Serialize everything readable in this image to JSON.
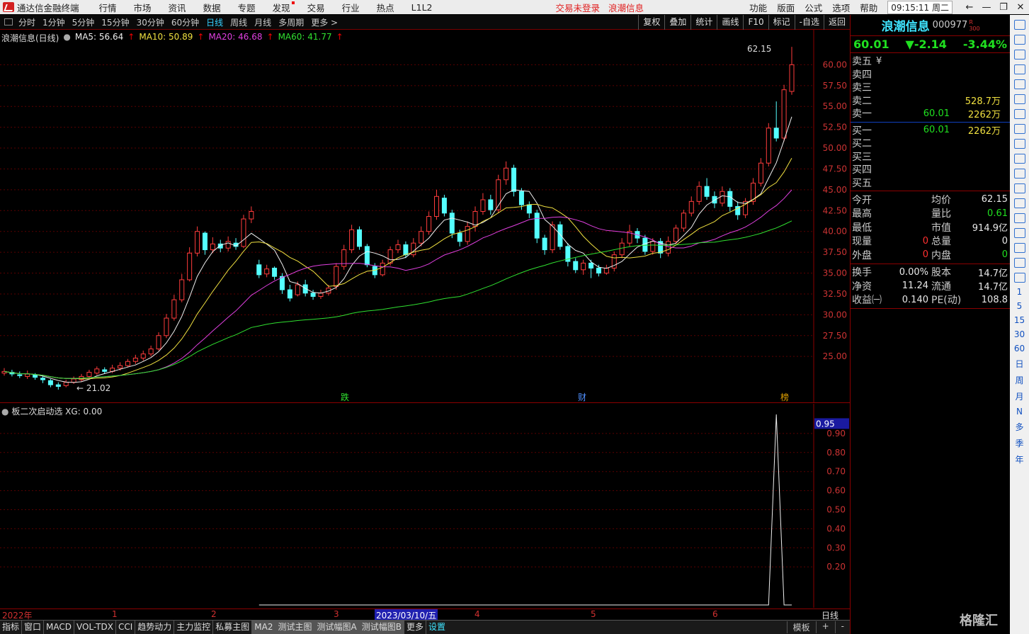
{
  "menubar": {
    "app_title": "通达信金融终端",
    "items": [
      "行情",
      "市场",
      "资讯",
      "数据",
      "专题",
      "发现",
      "交易",
      "行业",
      "热点",
      "L1L2"
    ],
    "alert_trade": "交易未登录",
    "alert_stock": "浪潮信息",
    "right_items": [
      "功能",
      "版面",
      "公式",
      "选项",
      "帮助"
    ],
    "clock": "09:15:11",
    "weekday": "周二"
  },
  "periodbar": {
    "items": [
      "分时",
      "1分钟",
      "5分钟",
      "15分钟",
      "30分钟",
      "60分钟",
      "日线",
      "周线",
      "月线",
      "多周期",
      "更多 >"
    ],
    "active": "日线",
    "tools": [
      "复权",
      "叠加",
      "统计",
      "画线",
      "F10",
      "标记",
      "-自选",
      "返回"
    ]
  },
  "main_legend": {
    "title": "浪潮信息(日线)",
    "ma5": "MA5: 56.64",
    "ma10": "MA10: 50.89",
    "ma20": "MA20: 46.68",
    "ma60": "MA60: 41.77"
  },
  "main_chart": {
    "price_labels": [
      "60.00",
      "57.50",
      "55.00",
      "52.50",
      "50.00",
      "47.50",
      "45.00",
      "42.50",
      "40.00",
      "37.50",
      "35.00",
      "32.50",
      "30.00",
      "27.50",
      "25.00"
    ],
    "high_label": "62.15",
    "low_label": "21.02",
    "markers": [
      "跌",
      "财",
      "榜"
    ]
  },
  "ind_legend": {
    "title": "板二次启动选",
    "xg": "XG: 0.00"
  },
  "ind_chart": {
    "value_label": "0.95",
    "axis_labels": [
      "0.90",
      "0.80",
      "0.70",
      "0.60",
      "0.50",
      "0.40",
      "0.30",
      "0.20"
    ]
  },
  "chart_data": {
    "type": "candlestick",
    "ylim": [
      20,
      62.5
    ],
    "candles": [
      [
        23.0,
        23.2,
        23.6,
        22.7
      ],
      [
        23.1,
        22.9,
        23.4,
        22.6
      ],
      [
        22.8,
        22.7,
        23.2,
        22.4
      ],
      [
        22.6,
        22.9,
        23.3,
        22.3
      ],
      [
        22.8,
        22.5,
        23.0,
        22.2
      ],
      [
        22.4,
        22.2,
        22.7,
        21.8
      ],
      [
        22.1,
        21.6,
        22.3,
        21.3
      ],
      [
        21.6,
        21.4,
        21.9,
        21.02
      ],
      [
        21.5,
        21.9,
        22.2,
        21.3
      ],
      [
        21.9,
        22.3,
        22.6,
        21.7
      ],
      [
        22.2,
        22.6,
        22.9,
        22.0
      ],
      [
        22.6,
        23.1,
        23.4,
        22.4
      ],
      [
        23.0,
        23.5,
        23.8,
        22.8
      ],
      [
        23.4,
        23.2,
        23.7,
        22.9
      ],
      [
        23.2,
        23.6,
        24.0,
        23.0
      ],
      [
        23.6,
        23.9,
        24.3,
        23.3
      ],
      [
        23.9,
        24.4,
        24.7,
        23.7
      ],
      [
        24.4,
        24.8,
        25.2,
        24.1
      ],
      [
        24.8,
        25.3,
        25.7,
        24.5
      ],
      [
        25.3,
        25.9,
        26.3,
        25.0
      ],
      [
        25.9,
        27.5,
        27.9,
        25.7
      ],
      [
        27.5,
        29.6,
        30.1,
        27.2
      ],
      [
        29.6,
        31.8,
        32.4,
        29.3
      ],
      [
        31.8,
        34.2,
        34.9,
        31.5
      ],
      [
        34.2,
        37.4,
        38.1,
        34.0
      ],
      [
        37.4,
        40.0,
        40.6,
        37.0
      ],
      [
        39.8,
        37.8,
        40.0,
        37.2
      ],
      [
        37.8,
        38.5,
        39.3,
        37.4
      ],
      [
        38.5,
        38.0,
        39.0,
        37.5
      ],
      [
        38.0,
        38.8,
        39.4,
        37.6
      ],
      [
        38.6,
        38.2,
        39.2,
        37.8
      ],
      [
        38.2,
        41.5,
        42.0,
        38.0
      ],
      [
        41.5,
        42.4,
        43.0,
        41.0
      ],
      [
        36.0,
        34.8,
        36.6,
        34.4
      ],
      [
        34.9,
        35.5,
        36.0,
        34.5
      ],
      [
        35.6,
        34.6,
        35.8,
        34.2
      ],
      [
        34.6,
        33.0,
        35.0,
        32.5
      ],
      [
        33.0,
        32.0,
        33.6,
        31.6
      ],
      [
        32.4,
        33.6,
        34.0,
        32.2
      ],
      [
        33.6,
        32.6,
        34.2,
        32.2
      ],
      [
        32.6,
        32.2,
        33.0,
        31.8
      ],
      [
        32.2,
        32.6,
        33.0,
        31.9
      ],
      [
        32.6,
        33.2,
        33.6,
        32.3
      ],
      [
        33.4,
        35.8,
        36.2,
        33.0
      ],
      [
        35.8,
        37.8,
        38.4,
        35.4
      ],
      [
        37.8,
        40.2,
        40.8,
        37.4
      ],
      [
        40.2,
        38.2,
        40.6,
        37.8
      ],
      [
        38.2,
        36.0,
        38.5,
        35.7
      ],
      [
        35.8,
        34.8,
        36.2,
        34.4
      ],
      [
        34.8,
        36.2,
        36.6,
        34.6
      ],
      [
        36.2,
        37.8,
        38.2,
        35.9
      ],
      [
        37.8,
        38.4,
        39.0,
        37.4
      ],
      [
        38.4,
        37.2,
        38.8,
        36.8
      ],
      [
        37.2,
        38.6,
        39.2,
        36.9
      ],
      [
        38.6,
        40.0,
        40.6,
        38.2
      ],
      [
        40.0,
        41.8,
        42.4,
        39.6
      ],
      [
        41.8,
        44.2,
        45.0,
        41.4
      ],
      [
        44.0,
        42.2,
        44.4,
        41.8
      ],
      [
        42.2,
        39.8,
        42.6,
        39.2
      ],
      [
        39.8,
        38.8,
        40.2,
        38.2
      ],
      [
        38.8,
        40.6,
        41.2,
        38.4
      ],
      [
        40.6,
        42.4,
        43.0,
        40.0
      ],
      [
        42.4,
        43.8,
        44.6,
        42.0
      ],
      [
        43.8,
        42.6,
        44.4,
        42.0
      ],
      [
        42.6,
        46.2,
        46.8,
        42.2
      ],
      [
        46.2,
        47.6,
        48.4,
        45.6
      ],
      [
        47.6,
        44.8,
        48.0,
        44.2
      ],
      [
        44.8,
        43.2,
        45.2,
        42.6
      ],
      [
        43.2,
        42.2,
        43.6,
        41.6
      ],
      [
        42.2,
        39.2,
        42.6,
        38.6
      ],
      [
        39.2,
        37.8,
        39.6,
        37.2
      ],
      [
        37.8,
        40.8,
        41.2,
        37.4
      ],
      [
        40.8,
        38.2,
        41.2,
        37.8
      ],
      [
        38.2,
        36.4,
        38.6,
        35.8
      ],
      [
        36.4,
        35.4,
        36.8,
        35.0
      ],
      [
        35.4,
        36.2,
        36.6,
        34.8
      ],
      [
        36.2,
        35.6,
        36.6,
        34.4
      ],
      [
        35.6,
        35.0,
        36.0,
        34.6
      ],
      [
        35.0,
        35.6,
        36.0,
        34.8
      ],
      [
        35.6,
        37.2,
        37.6,
        35.2
      ],
      [
        37.2,
        38.6,
        39.2,
        36.8
      ],
      [
        38.6,
        40.0,
        40.8,
        38.2
      ],
      [
        40.0,
        39.2,
        40.4,
        38.6
      ],
      [
        39.2,
        37.6,
        39.6,
        37.2
      ],
      [
        37.6,
        38.8,
        39.2,
        37.2
      ],
      [
        38.8,
        37.4,
        39.2,
        36.8
      ],
      [
        37.4,
        38.8,
        39.4,
        37.0
      ],
      [
        38.8,
        40.4,
        40.8,
        38.4
      ],
      [
        40.4,
        42.2,
        42.6,
        40.0
      ],
      [
        42.2,
        43.6,
        44.2,
        41.8
      ],
      [
        43.6,
        45.4,
        46.0,
        43.2
      ],
      [
        45.4,
        44.2,
        46.4,
        43.8
      ],
      [
        44.2,
        43.4,
        44.8,
        42.8
      ],
      [
        43.4,
        44.8,
        45.4,
        43.0
      ],
      [
        44.8,
        43.0,
        45.2,
        42.4
      ],
      [
        43.0,
        42.0,
        43.6,
        41.4
      ],
      [
        42.0,
        43.6,
        44.0,
        41.6
      ],
      [
        43.6,
        45.8,
        46.4,
        43.2
      ],
      [
        45.8,
        48.2,
        48.8,
        45.4
      ],
      [
        48.2,
        52.4,
        53.0,
        47.8
      ],
      [
        52.4,
        51.2,
        55.6,
        50.8
      ],
      [
        51.2,
        57.0,
        57.6,
        50.8
      ],
      [
        56.8,
        60.0,
        62.15,
        56.4
      ]
    ],
    "ind_values": [
      0,
      0,
      0,
      0,
      0,
      0,
      0,
      0,
      0,
      0,
      0,
      0,
      0,
      0,
      0,
      0,
      0,
      0,
      0,
      0,
      0,
      0,
      0,
      0,
      0,
      0,
      0,
      0,
      0,
      0,
      0,
      0,
      0,
      0,
      0,
      0,
      0,
      0,
      0,
      0,
      0,
      0,
      0,
      0,
      0,
      0,
      0,
      0,
      0,
      0,
      0,
      0,
      0,
      0,
      0,
      0,
      0,
      0,
      0,
      0,
      0,
      0,
      0,
      0,
      0,
      0,
      0,
      0,
      0,
      0,
      0,
      0,
      0,
      0,
      0,
      0,
      0,
      0,
      0,
      0,
      0,
      0,
      0,
      0,
      0,
      0,
      0,
      0,
      0,
      0,
      0,
      0,
      0,
      0,
      0,
      0,
      0,
      0,
      0,
      0,
      1,
      0,
      0
    ],
    "ind_ylim": [
      0,
      1.0
    ]
  },
  "datebar": {
    "labels": [
      "2022年",
      "1",
      "2",
      "3",
      "2023/03/10/五",
      "4",
      "5",
      "6"
    ],
    "right": "日线"
  },
  "tabbar": {
    "tabs": [
      "指标",
      "窗口",
      "MACD",
      "VOL-TDX",
      "CCI",
      "趋势动力",
      "主力监控",
      "私募主图",
      "MA2",
      "测试主图",
      "测试幅图A",
      "测试幅图B",
      "更多",
      "设置"
    ],
    "right": [
      "模板",
      "+",
      "-"
    ]
  },
  "quote": {
    "name": "浪潮信息",
    "code": "000977",
    "code_badge": "R 300",
    "price": "60.01",
    "change": "▼-2.14",
    "pct": "-3.44%",
    "asks": [
      {
        "label": "卖五",
        "price": "¥",
        "vol": ""
      },
      {
        "label": "卖四",
        "price": "",
        "vol": ""
      },
      {
        "label": "卖三",
        "price": "",
        "vol": ""
      },
      {
        "label": "卖二",
        "price": "",
        "vol": "528.7万"
      },
      {
        "label": "卖一",
        "price": "60.01",
        "vol": "2262万"
      }
    ],
    "bids": [
      {
        "label": "买一",
        "price": "60.01",
        "vol": "2262万"
      },
      {
        "label": "买二",
        "price": "",
        "vol": ""
      },
      {
        "label": "买三",
        "price": "",
        "vol": ""
      },
      {
        "label": "买四",
        "price": "",
        "vol": ""
      },
      {
        "label": "买五",
        "price": "",
        "vol": ""
      }
    ],
    "stats1": [
      [
        "今开",
        "",
        "均价",
        "62.15"
      ],
      [
        "最高",
        "",
        "量比",
        "0.61"
      ],
      [
        "最低",
        "",
        "市值",
        "914.9亿"
      ],
      [
        "现量",
        "0",
        "总量",
        "0"
      ],
      [
        "外盘",
        "0",
        "内盘",
        "0"
      ]
    ],
    "stats2": [
      [
        "换手",
        "0.00%",
        "股本",
        "14.7亿"
      ],
      [
        "净资",
        "11.24",
        "流通",
        "14.7亿"
      ],
      [
        "收益㈠",
        "0.140",
        "PE(动)",
        "108.8"
      ]
    ]
  },
  "rtool": {
    "texts": [
      "1",
      "5",
      "15",
      "30",
      "60",
      "日",
      "周",
      "月",
      "N",
      "多",
      "季",
      "年"
    ]
  },
  "watermark": "格隆汇"
}
